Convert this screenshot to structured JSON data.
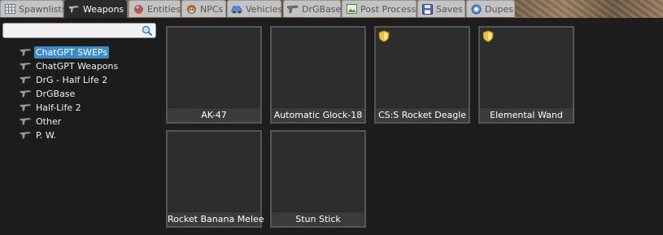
{
  "tabs": [
    {
      "label": "Spawnlists",
      "icon": "spawnlist-grid-icon",
      "active": false
    },
    {
      "label": "Weapons",
      "icon": "weapon-gun-icon",
      "active": true
    },
    {
      "label": "Entities",
      "icon": "entities-ball-icon",
      "active": false
    },
    {
      "label": "NPCs",
      "icon": "npc-monkey-icon",
      "active": false
    },
    {
      "label": "Vehicles",
      "icon": "vehicle-car-icon",
      "active": false
    },
    {
      "label": "DrGBase",
      "icon": "drgbase-gun-icon",
      "active": false
    },
    {
      "label": "Post Process",
      "icon": "post-process-picture-icon",
      "active": false
    },
    {
      "label": "Saves",
      "icon": "saves-disk-icon",
      "active": false
    },
    {
      "label": "Dupes",
      "icon": "dupes-icon",
      "active": false
    }
  ],
  "search": {
    "value": "",
    "placeholder": ""
  },
  "tree": [
    {
      "label": "ChatGPT SWEPs",
      "selected": true
    },
    {
      "label": "ChatGPT Weapons",
      "selected": false
    },
    {
      "label": "DrG - Half Life 2",
      "selected": false
    },
    {
      "label": "DrGBase",
      "selected": false
    },
    {
      "label": "Half-Life 2",
      "selected": false
    },
    {
      "label": "Other",
      "selected": false
    },
    {
      "label": "P. W.",
      "selected": false
    }
  ],
  "weapons": [
    {
      "label": "AK-47",
      "admin_only": false
    },
    {
      "label": "Automatic Glock-18",
      "admin_only": false
    },
    {
      "label": "CS:S Rocket Deagle",
      "admin_only": true
    },
    {
      "label": "Elemental Wand",
      "admin_only": true
    },
    {
      "label": "Rocket Banana Melee",
      "admin_only": false
    },
    {
      "label": "Stun Stick",
      "admin_only": false
    }
  ],
  "colors": {
    "selection": "#3c8ac8",
    "active_tab": "#2b2b2b",
    "inactive_tab": "#c3c3c3",
    "admin_badge": "#e8c33a"
  }
}
